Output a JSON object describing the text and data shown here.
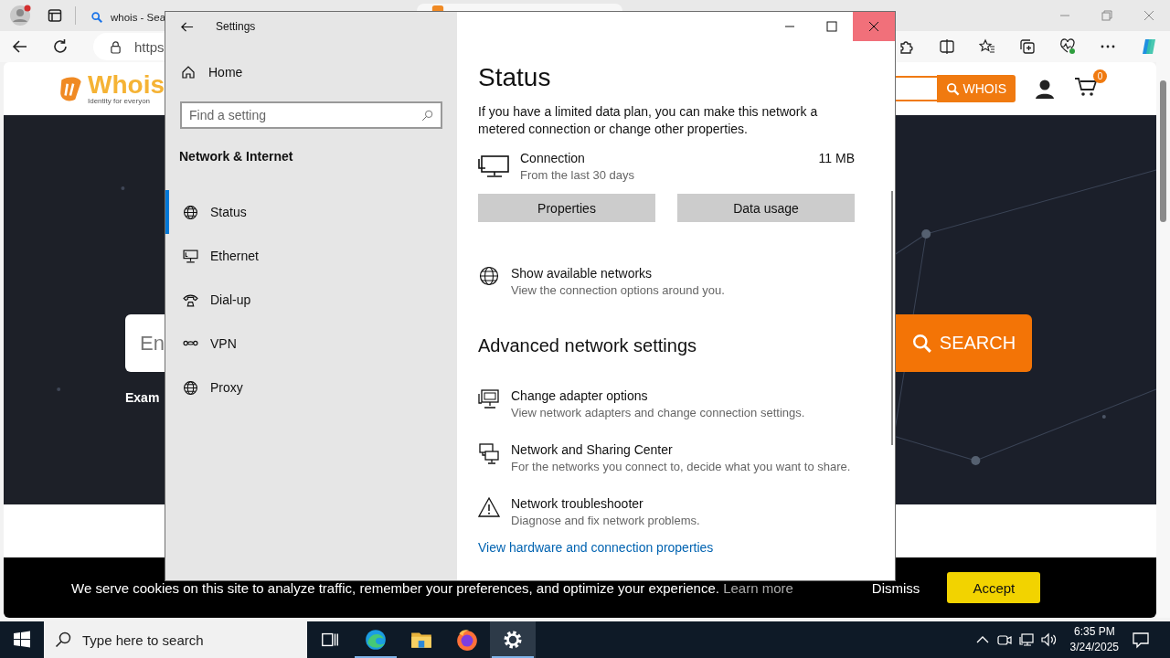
{
  "browser": {
    "tabs": [
      {
        "title": "whois - Sea",
        "selected": false
      },
      {
        "selected": true
      }
    ],
    "address": "https"
  },
  "site": {
    "logo": "Whois",
    "tagline": "Identity for everyon",
    "whois_button": "WHOIS",
    "cart_count": "0",
    "search_placeholder": "En",
    "search_button": "SEARCH",
    "example": "Exam",
    "cookie": {
      "text": "We serve cookies on this site to analyze traffic, remember your preferences, and optimize your experience.",
      "link": "Learn more",
      "dismiss": "Dismiss",
      "accept": "Accept"
    }
  },
  "settings": {
    "title": "Settings",
    "home": "Home",
    "search_placeholder": "Find a setting",
    "section": "Network & Internet",
    "nav": [
      {
        "label": "Status",
        "kind": "globe",
        "selected": true
      },
      {
        "label": "Ethernet",
        "kind": "ethernet",
        "selected": false
      },
      {
        "label": "Dial-up",
        "kind": "dialup",
        "selected": false
      },
      {
        "label": "VPN",
        "kind": "vpn",
        "selected": false
      },
      {
        "label": "Proxy",
        "kind": "globe",
        "selected": false
      }
    ],
    "heading": "Status",
    "description": "If you have a limited data plan, you can make this network a metered connection or change other properties.",
    "connection": {
      "name": "Connection",
      "period": "From the last 30 days",
      "usage": "11 MB"
    },
    "buttons": [
      "Properties",
      "Data usage"
    ],
    "networks": {
      "kind": "globe",
      "title": "Show available networks",
      "subtitle": "View the connection options around you."
    },
    "advanced_heading": "Advanced network settings",
    "advanced": [
      {
        "kind": "adapter",
        "title": "Change adapter options",
        "subtitle": "View network adapters and change connection settings."
      },
      {
        "kind": "sharing",
        "title": "Network and Sharing Center",
        "subtitle": "For the networks you connect to, decide what you want to share."
      },
      {
        "kind": "warning",
        "title": "Network troubleshooter",
        "subtitle": "Diagnose and fix network problems."
      }
    ],
    "link": "View hardware and connection properties"
  },
  "taskbar": {
    "search_placeholder": "Type here to search",
    "apps": [
      {
        "kind": "taskview",
        "running": false,
        "selected": false
      },
      {
        "kind": "edge",
        "running": true,
        "selected": false
      },
      {
        "kind": "folder",
        "running": false,
        "selected": false
      },
      {
        "kind": "firefox",
        "running": false,
        "selected": false
      },
      {
        "kind": "gear",
        "running": true,
        "selected": true
      }
    ],
    "time": "6:35 PM",
    "date": "3/24/2025"
  }
}
